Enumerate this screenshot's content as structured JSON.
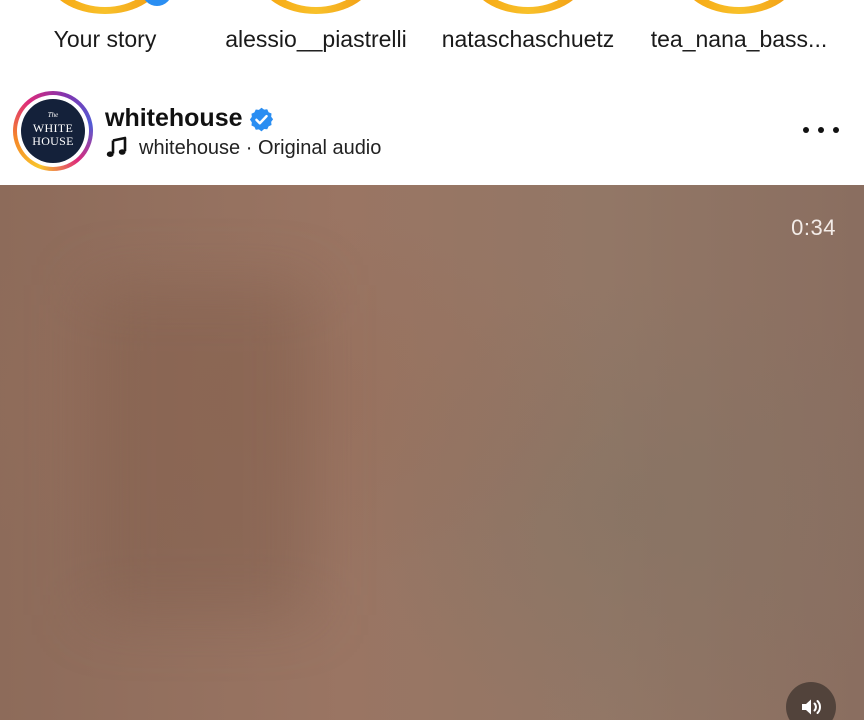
{
  "stories": [
    {
      "label": "Your story"
    },
    {
      "label": "alessio__piastrelli"
    },
    {
      "label": "nataschaschuetz"
    },
    {
      "label": "tea_nana_bass..."
    }
  ],
  "post": {
    "username": "whitehouse",
    "avatar_lines": [
      "The",
      "WHITE",
      "HOUSE"
    ],
    "audio_owner": "whitehouse",
    "audio_separator": " · ",
    "audio_label": "Original audio",
    "video_time": "0:34"
  },
  "icons": {
    "verified": "verified-badge-icon",
    "music": "music-note-icon",
    "more": "more-options-icon",
    "sound": "speaker-icon"
  },
  "colors": {
    "verified_blue": "#2a8ef2",
    "story_ring": "#f6a30f"
  }
}
